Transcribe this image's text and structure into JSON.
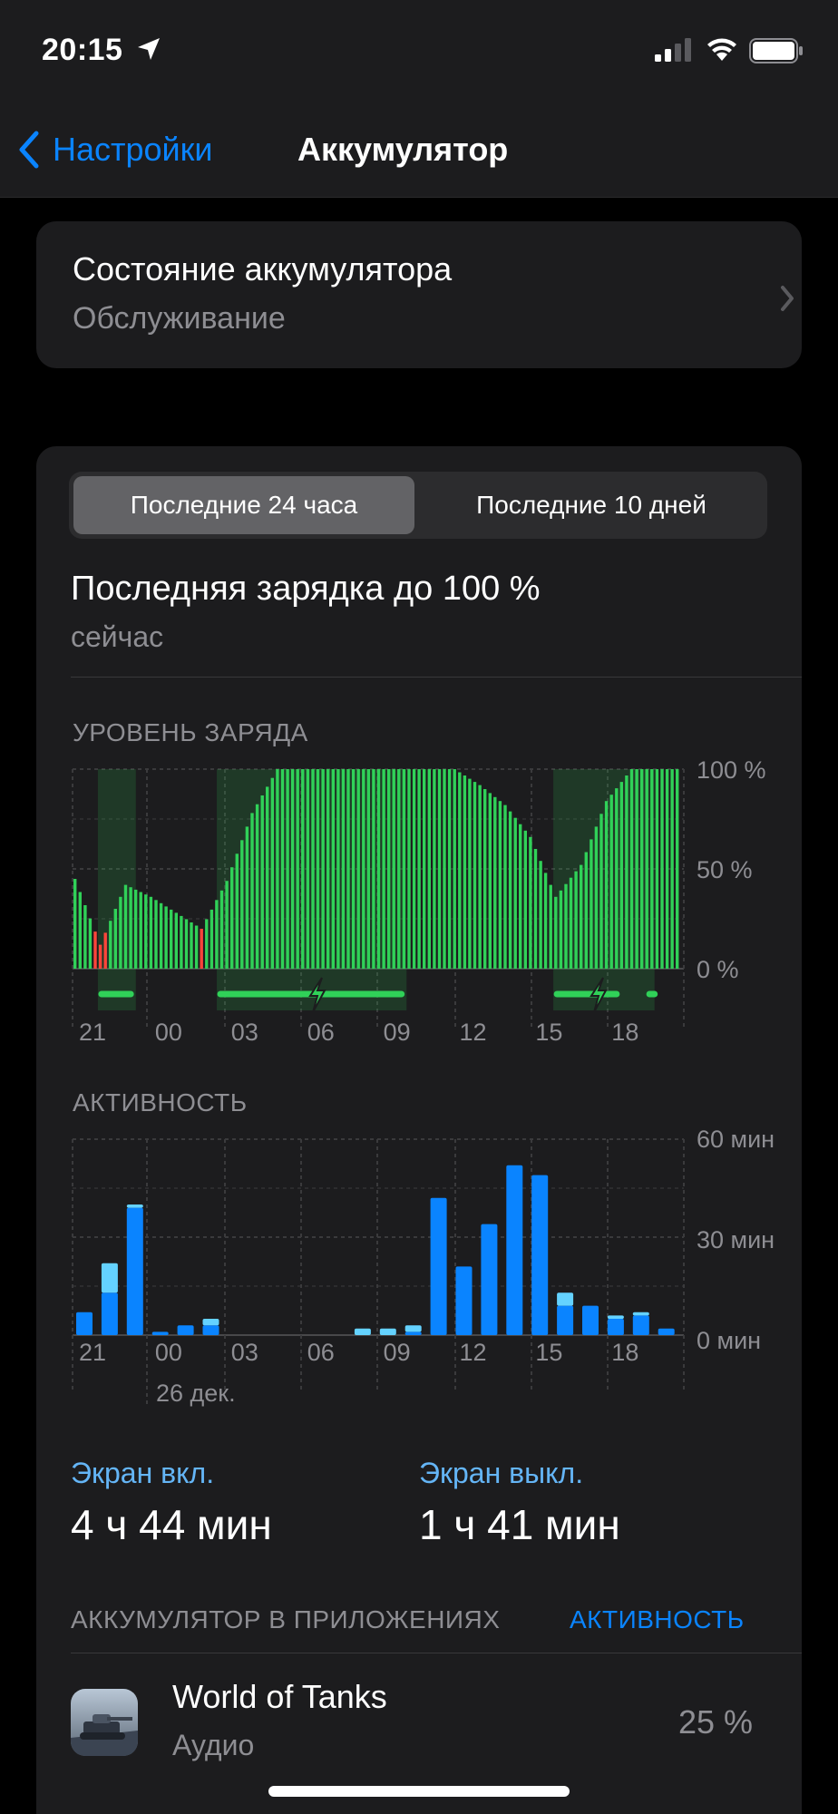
{
  "status_bar": {
    "time": "20:15"
  },
  "nav": {
    "back_label": "Настройки",
    "title": "Аккумулятор"
  },
  "health": {
    "title": "Состояние аккумулятора",
    "subtitle": "Обслуживание"
  },
  "segment": {
    "options": [
      "Последние 24 часа",
      "Последние 10 дней"
    ],
    "selected": 0
  },
  "last_charge": {
    "title": "Последняя зарядка до 100 %",
    "time": "сейчас"
  },
  "battery_chart": {
    "label": "УРОВЕНЬ ЗАРЯДА",
    "y_ticks": [
      "100 %",
      "50 %",
      "0 %"
    ],
    "x_ticks": [
      "21",
      "00",
      "03",
      "06",
      "09",
      "12",
      "15",
      "18"
    ]
  },
  "activity_chart": {
    "label": "АКТИВНОСТЬ",
    "y_ticks": [
      "60 мин",
      "30 мин",
      "0 мин"
    ],
    "x_ticks": [
      "21",
      "00",
      "03",
      "06",
      "09",
      "12",
      "15",
      "18"
    ],
    "date_label": "26 дек."
  },
  "chart_data": [
    {
      "type": "bar",
      "title": "УРОВЕНЬ ЗАРЯДА",
      "ylim": [
        0,
        100
      ],
      "y_unit": "%",
      "categories": [
        "20",
        "21",
        "22",
        "23",
        "00",
        "01",
        "02",
        "03",
        "04",
        "05",
        "06",
        "07",
        "08",
        "09",
        "10",
        "11",
        "12",
        "13",
        "14",
        "15",
        "16",
        "17",
        "18",
        "19"
      ],
      "series": [
        {
          "values": [
            45,
            12,
            42,
            36,
            28,
            20,
            44,
            78,
            100,
            100,
            100,
            100,
            100,
            100,
            100,
            100,
            92,
            82,
            66,
            36,
            52,
            84,
            100,
            100
          ]
        }
      ],
      "low_color": "#ff453a",
      "normal_color": "#30d158"
    },
    {
      "type": "bar",
      "title": "АКТИВНОСТЬ",
      "ylim": [
        0,
        60
      ],
      "y_unit": "мин",
      "categories": [
        "20",
        "21",
        "22",
        "23",
        "00",
        "01",
        "02",
        "03",
        "04",
        "05",
        "06",
        "07",
        "08",
        "09",
        "10",
        "11",
        "12",
        "13",
        "14",
        "15",
        "16",
        "17",
        "18",
        "19"
      ],
      "series": [
        {
          "values": [
            7,
            13,
            39,
            1,
            3,
            3,
            0,
            0,
            0,
            0,
            0,
            0,
            0,
            1,
            42,
            21,
            34,
            52,
            49,
            9,
            9,
            5,
            6,
            2
          ]
        },
        {
          "values": [
            0,
            9,
            1,
            0,
            0,
            2,
            0,
            0,
            0,
            0,
            0,
            2,
            2,
            2,
            0,
            0,
            0,
            0,
            0,
            4,
            0,
            1,
            1,
            0
          ]
        }
      ],
      "colors": [
        "#0a84ff",
        "#64d2ff"
      ]
    }
  ],
  "screen_stats": {
    "on_label": "Экран вкл.",
    "on_value": "4 ч 44 мин",
    "off_label": "Экран выкл.",
    "off_value": "1 ч 41 мин"
  },
  "apps": {
    "header": "АККУМУЛЯТОР В ПРИЛОЖЕНИЯХ",
    "action": "АКТИВНОСТЬ",
    "items": [
      {
        "name": "World of Tanks",
        "type": "Аудио",
        "percent": "25 %"
      }
    ]
  }
}
